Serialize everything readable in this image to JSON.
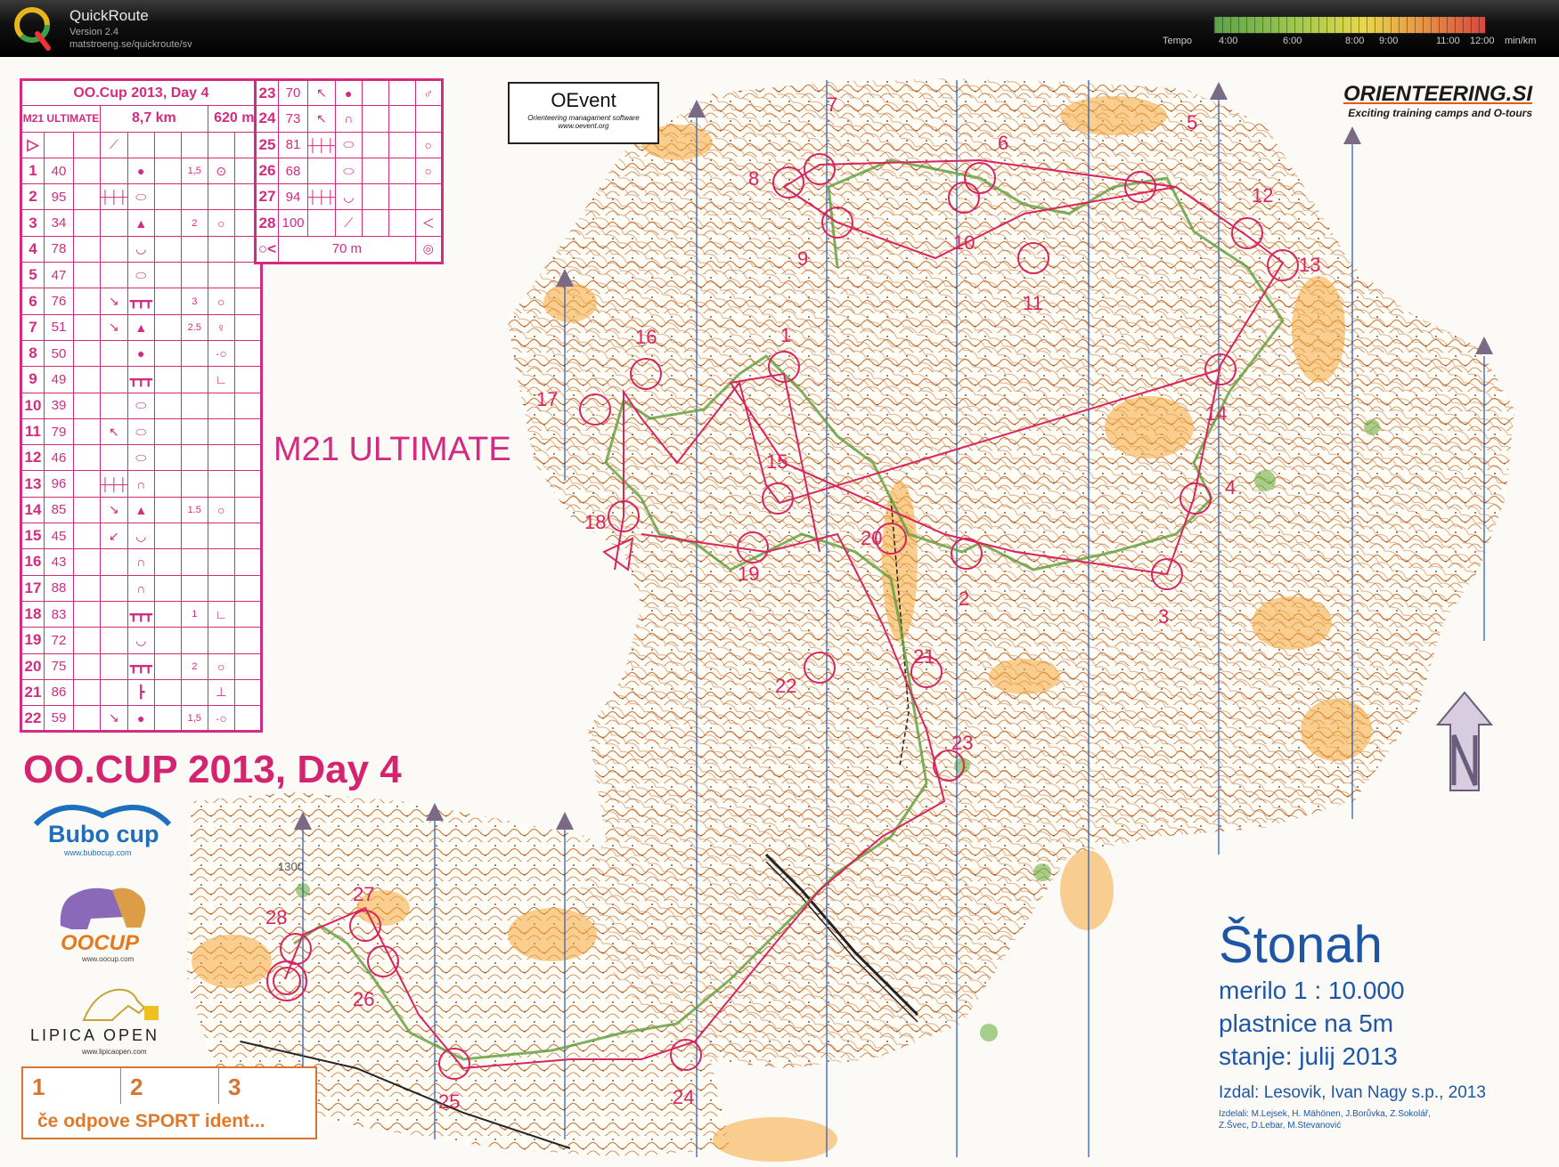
{
  "app": {
    "name": "QuickRoute",
    "version": "Version 2.4",
    "url": "matstroeng.se/quickroute/sv",
    "logo_letter": "Q"
  },
  "tempo": {
    "label": "Tempo",
    "ticks": [
      "4:00",
      "6:00",
      "8:00",
      "9:00",
      "11:00",
      "12:00"
    ],
    "unit": "min/km"
  },
  "course_card": {
    "title": "OO.Cup 2013, Day 4",
    "course": "M21 ULTIMATE",
    "length": "8,7 km",
    "climb": "620 m",
    "controls": [
      {
        "n": "1",
        "code": "40",
        "dir": "",
        "feat": "●",
        "dim": "1,5",
        "loc": "⊙"
      },
      {
        "n": "2",
        "code": "95",
        "dir": "┼┼┼",
        "feat": "⬭",
        "dim": "",
        "loc": ""
      },
      {
        "n": "3",
        "code": "34",
        "dir": "",
        "feat": "▲",
        "dim": "2",
        "loc": "○"
      },
      {
        "n": "4",
        "code": "78",
        "dir": "",
        "feat": "◡",
        "dim": "",
        "loc": ""
      },
      {
        "n": "5",
        "code": "47",
        "dir": "",
        "feat": "⬭",
        "dim": "",
        "loc": ""
      },
      {
        "n": "6",
        "code": "76",
        "dir": "↘",
        "feat": "┳┳┳",
        "dim": "3",
        "loc": "○"
      },
      {
        "n": "7",
        "code": "51",
        "dir": "↘",
        "feat": "▲",
        "dim": "2.5",
        "loc": "♀"
      },
      {
        "n": "8",
        "code": "50",
        "dir": "",
        "feat": "●",
        "dim": "",
        "loc": "·○"
      },
      {
        "n": "9",
        "code": "49",
        "dir": "",
        "feat": "┳┳┳",
        "dim": "",
        "loc": "∟"
      },
      {
        "n": "10",
        "code": "39",
        "dir": "",
        "feat": "⬭",
        "dim": "",
        "loc": ""
      },
      {
        "n": "11",
        "code": "79",
        "dir": "↖",
        "feat": "⬭",
        "dim": "",
        "loc": ""
      },
      {
        "n": "12",
        "code": "46",
        "dir": "",
        "feat": "⬭",
        "dim": "",
        "loc": ""
      },
      {
        "n": "13",
        "code": "96",
        "dir": "┼┼┼",
        "feat": "∩",
        "dim": "",
        "loc": ""
      },
      {
        "n": "14",
        "code": "85",
        "dir": "↘",
        "feat": "▲",
        "dim": "1.5",
        "loc": "○"
      },
      {
        "n": "15",
        "code": "45",
        "dir": "↙",
        "feat": "◡",
        "dim": "",
        "loc": ""
      },
      {
        "n": "16",
        "code": "43",
        "dir": "",
        "feat": "∩",
        "dim": "",
        "loc": ""
      },
      {
        "n": "17",
        "code": "88",
        "dir": "",
        "feat": "∩",
        "dim": "",
        "loc": ""
      },
      {
        "n": "18",
        "code": "83",
        "dir": "",
        "feat": "┳┳┳",
        "dim": "1",
        "loc": "∟"
      },
      {
        "n": "19",
        "code": "72",
        "dir": "",
        "feat": "◡",
        "dim": "",
        "loc": ""
      },
      {
        "n": "20",
        "code": "75",
        "dir": "",
        "feat": "┳┳┳",
        "dim": "2",
        "loc": "○"
      },
      {
        "n": "21",
        "code": "86",
        "dir": "",
        "feat": "┣",
        "dim": "",
        "loc": "⊥"
      },
      {
        "n": "22",
        "code": "59",
        "dir": "↘",
        "feat": "●",
        "dim": "1,5",
        "loc": "·○"
      }
    ],
    "controls_b": [
      {
        "n": "23",
        "code": "70",
        "dir": "↖",
        "feat": "●",
        "loc": "♂"
      },
      {
        "n": "24",
        "code": "73",
        "dir": "↖",
        "feat": "∩",
        "loc": ""
      },
      {
        "n": "25",
        "code": "81",
        "dir": "┼┼┼",
        "feat": "⬭",
        "loc": "○"
      },
      {
        "n": "26",
        "code": "68",
        "dir": "",
        "feat": "⬭",
        "loc": "○"
      },
      {
        "n": "27",
        "code": "94",
        "dir": "┼┼┼",
        "feat": "◡",
        "loc": ""
      },
      {
        "n": "28",
        "code": "100",
        "dir": "",
        "feat": "⟋",
        "loc": "＜"
      }
    ],
    "finish_distance": "70 m"
  },
  "map_labels": {
    "course_label": "M21 ULTIMATE",
    "event_title": "OO.CUP 2013, Day 4",
    "control_numbers": [
      "1",
      "2",
      "3",
      "4",
      "5",
      "6",
      "7",
      "8",
      "9",
      "10",
      "11",
      "12",
      "13",
      "14",
      "15",
      "16",
      "17",
      "18",
      "19",
      "20",
      "21",
      "22",
      "23",
      "24",
      "25",
      "26",
      "27",
      "28"
    ],
    "height_mark": "1300"
  },
  "sponsors": {
    "oevent": {
      "name": "OEvent",
      "sub": "Orienteering managament software",
      "url": "www.oevent.org"
    },
    "orienteering_si": {
      "name": "ORIENTEERING.SI",
      "tag": "Exciting training camps and O-tours"
    },
    "bubo": {
      "name": "Bubo cup",
      "url": "www.bubocup.com"
    },
    "oocup": {
      "name": "OOCUP",
      "url": "www.oocup.com"
    },
    "lipica": {
      "name": "LIPICA OPEN",
      "url": "www.lipicaopen.com"
    }
  },
  "si_backup": {
    "boxes": [
      "1",
      "2",
      "3"
    ],
    "note": "če odpove SPORT ident..."
  },
  "legend": {
    "map_name": "Štonah",
    "scale": "merilo 1 : 10.000",
    "contours": "plastnice na 5m",
    "state": "stanje: julij 2013",
    "publisher": "Izdal: Lesovik, Ivan Nagy s.p., 2013",
    "credits_line1": "Izdelali: M.Lejsek, H. Mähönen, J.Borůvka, Z.Sokolář,",
    "credits_line2": "Z.Švec, D.Lebar, M.Stevanović"
  },
  "colors": {
    "course_magenta": "#d42a80",
    "legend_blue": "#1e56a6",
    "route_green": "#5a9e3a",
    "contour_brown": "#c46a2a",
    "open_land": "#f5b24a"
  }
}
